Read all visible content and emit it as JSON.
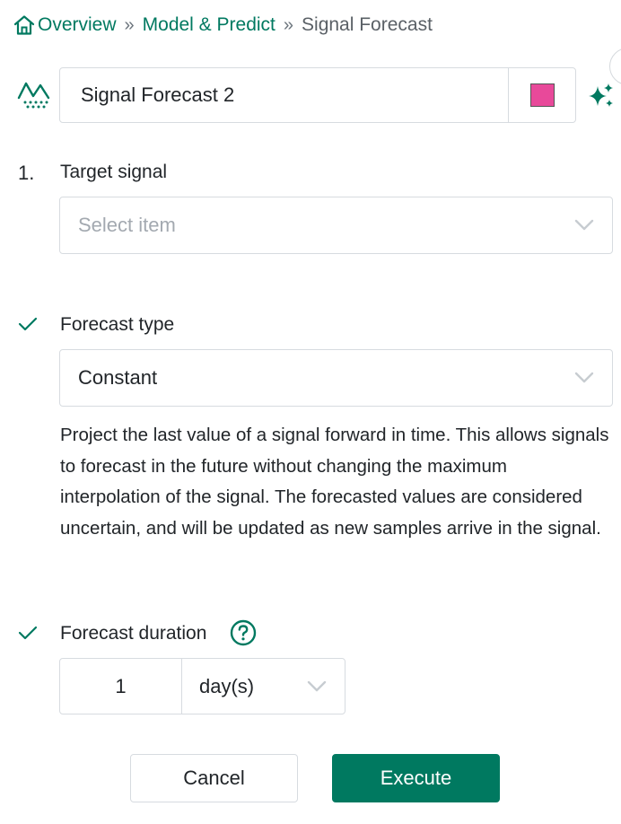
{
  "breadcrumb": {
    "items": [
      "Overview",
      "Model & Predict"
    ],
    "separator": "»",
    "current": "Signal Forecast"
  },
  "tool": {
    "name_value": "Signal Forecast 2",
    "color": "#e8499a",
    "accent_color": "#007960"
  },
  "steps": {
    "target": {
      "number": "1.",
      "label": "Target signal",
      "placeholder": "Select item"
    },
    "forecast_type": {
      "label": "Forecast type",
      "selected": "Constant",
      "description": "Project the last value of a signal forward in time. This allows signals to forecast in the future without changing the maximum interpolation of the signal. The forecasted values are considered uncertain, and will be updated as new samples arrive in the signal."
    },
    "duration": {
      "label": "Forecast duration",
      "value": "1",
      "unit": "day(s)"
    }
  },
  "buttons": {
    "cancel": "Cancel",
    "execute": "Execute"
  }
}
